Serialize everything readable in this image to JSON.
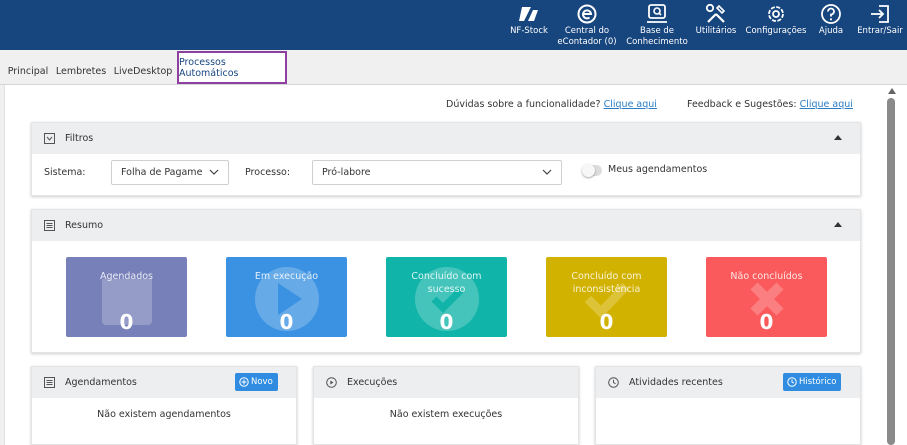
{
  "topnav": {
    "items": [
      {
        "id": "nfstock",
        "label": "NF-Stock"
      },
      {
        "id": "central",
        "label_line1": "Central do",
        "label_line2": "eContador (0)"
      },
      {
        "id": "base",
        "label_line1": "Base de",
        "label_line2": "Conhecimento"
      },
      {
        "id": "utilitarios",
        "label": "Utilitários"
      },
      {
        "id": "config",
        "label": "Configurações"
      },
      {
        "id": "ajuda",
        "label": "Ajuda"
      },
      {
        "id": "sair",
        "label": "Entrar/Sair"
      }
    ]
  },
  "tabs": [
    {
      "label": "Principal",
      "active": false
    },
    {
      "label": "Lembretes",
      "active": false
    },
    {
      "label": "LiveDesktop",
      "active": false
    },
    {
      "label": "Processos Automáticos",
      "active": true
    }
  ],
  "help": {
    "question": "Dúvidas sobre a funcionalidade?",
    "question_link": "Clique aqui",
    "feedback": "Feedback e Sugestões:",
    "feedback_link": "Clique aqui"
  },
  "filters": {
    "title": "Filtros",
    "sistema_label": "Sistema:",
    "sistema_value": "Folha de Pagame",
    "processo_label": "Processo:",
    "processo_value": "Pró-labore",
    "toggle_label": "Meus agendamentos",
    "toggle_on": false
  },
  "summary": {
    "title": "Resumo",
    "cards": [
      {
        "title_line1": "Agendados",
        "title_line2": "",
        "count": "0",
        "color": "#7780b8",
        "icon": "calendar-icon"
      },
      {
        "title_line1": "Em execução",
        "title_line2": "",
        "count": "0",
        "color": "#3b92e2",
        "icon": "play-icon"
      },
      {
        "title_line1": "Concluído com",
        "title_line2": "sucesso",
        "count": "0",
        "color": "#10b4a8",
        "icon": "check-icon"
      },
      {
        "title_line1": "Concluído com",
        "title_line2": "inconsistência",
        "count": "0",
        "color": "#d2b200",
        "icon": "check-icon"
      },
      {
        "title_line1": "Não concluídos",
        "title_line2": "",
        "count": "0",
        "color": "#fb5a5c",
        "icon": "x-icon"
      }
    ]
  },
  "agendamentos": {
    "title": "Agendamentos",
    "button": "Novo",
    "empty": "Não existem agendamentos"
  },
  "execucoes": {
    "title": "Execuções",
    "empty": "Não existem execuções"
  },
  "atividades": {
    "title": "Atividades recentes",
    "button": "Histórico"
  },
  "colors": {
    "topbar": "#17457e",
    "active_tab_border": "#8e3fa0",
    "link": "#2a7dc6",
    "button": "#2f8ce0"
  }
}
